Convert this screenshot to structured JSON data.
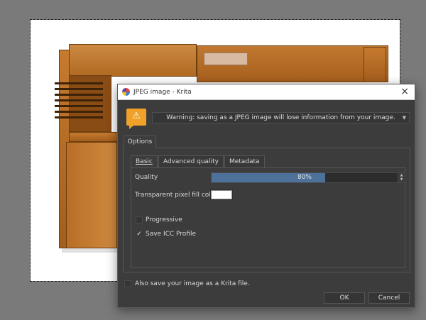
{
  "dialog": {
    "title": "JPEG image - Krita",
    "close_glyph": "×",
    "warning_icon": "warning-triangle-icon",
    "warning_glyph": "⚠",
    "warning_text": "Warning: saving as a JPEG image will lose information from your image.",
    "warning_arrow": "▼",
    "tab_options": "Options",
    "subtabs": [
      "Basic",
      "Advanced quality",
      "Metadata"
    ],
    "quality_label": "Quality",
    "quality_text": "80%",
    "quality_fraction": 0.8,
    "spin_up": "▲",
    "spin_down": "▼",
    "fill_color_label": "Transparent pixel fill color:",
    "fill_color": "#ffffff",
    "progressive_label": "Progressive",
    "progressive_checked": false,
    "icc_label": "Save ICC Profile",
    "icc_checked": true,
    "check_mark": "✓",
    "krita_label": "Also save your image as a Krita file.",
    "krita_checked": false,
    "ok_label": "OK",
    "cancel_label": "Cancel"
  },
  "colors": {
    "dialog_bg": "#3c3c3c",
    "accent_bar": "#4e7199",
    "warning": "#f0a12a",
    "wood": "#b86d27"
  }
}
